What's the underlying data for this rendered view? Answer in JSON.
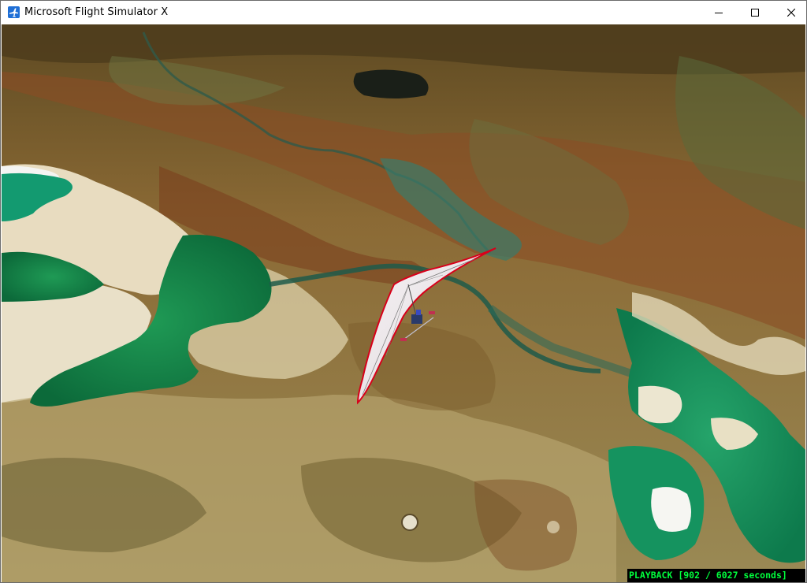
{
  "window": {
    "title": "Microsoft Flight Simulator X",
    "icon": "airplane-icon",
    "controls": {
      "minimize": "minimize-icon",
      "maximize": "maximize-icon",
      "close": "close-icon"
    }
  },
  "hud": {
    "playback_label": "PLAYBACK",
    "playback_position": "[902 / 6027 seconds]"
  },
  "colors": {
    "hud_text": "#00ff3c",
    "hud_background": "#000000",
    "glider_wing": "#f2eef0",
    "glider_edge": "#e0001a"
  }
}
